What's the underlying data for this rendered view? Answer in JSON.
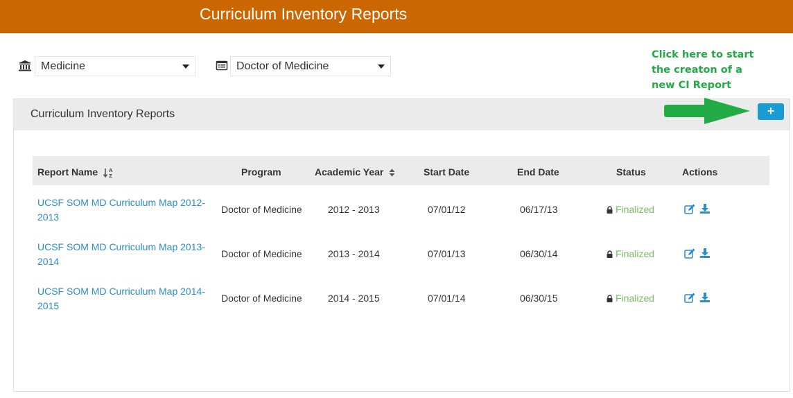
{
  "header": {
    "title": "Curriculum Inventory Reports"
  },
  "filters": {
    "school": {
      "icon": "institution-icon",
      "value": "Medicine"
    },
    "program": {
      "icon": "list-alt-icon",
      "value": "Doctor of Medicine"
    }
  },
  "callout": {
    "lines": [
      "Click here to start",
      "the creaton of a",
      "new CI Report"
    ],
    "color": "#22aa44"
  },
  "panel": {
    "title": "Curriculum Inventory Reports",
    "add_button": {
      "label": "+",
      "color": "#1a9bd2"
    }
  },
  "table": {
    "headers": [
      "Report Name",
      "Program",
      "Academic Year",
      "Start Date",
      "End Date",
      "Status",
      "Actions"
    ],
    "rows": [
      {
        "name_line1": "UCSF SOM MD Curriculum Map 2012-",
        "name_line2": "2013",
        "program": "Doctor of Medicine",
        "year": "2012 - 2013",
        "start": "07/01/12",
        "end": "06/17/13",
        "status": "Finalized"
      },
      {
        "name_line1": "UCSF SOM MD Curriculum Map 2013-",
        "name_line2": "2014",
        "program": "Doctor of Medicine",
        "year": "2013 - 2014",
        "start": "07/01/13",
        "end": "06/30/14",
        "status": "Finalized"
      },
      {
        "name_line1": "UCSF SOM MD Curriculum Map 2014-",
        "name_line2": "2015",
        "program": "Doctor of Medicine",
        "year": "2014 - 2015",
        "start": "07/01/14",
        "end": "06/30/15",
        "status": "Finalized"
      }
    ]
  },
  "colors": {
    "topbar": "#cc6600",
    "link": "#2a8dc5",
    "status": "#7cb962"
  }
}
